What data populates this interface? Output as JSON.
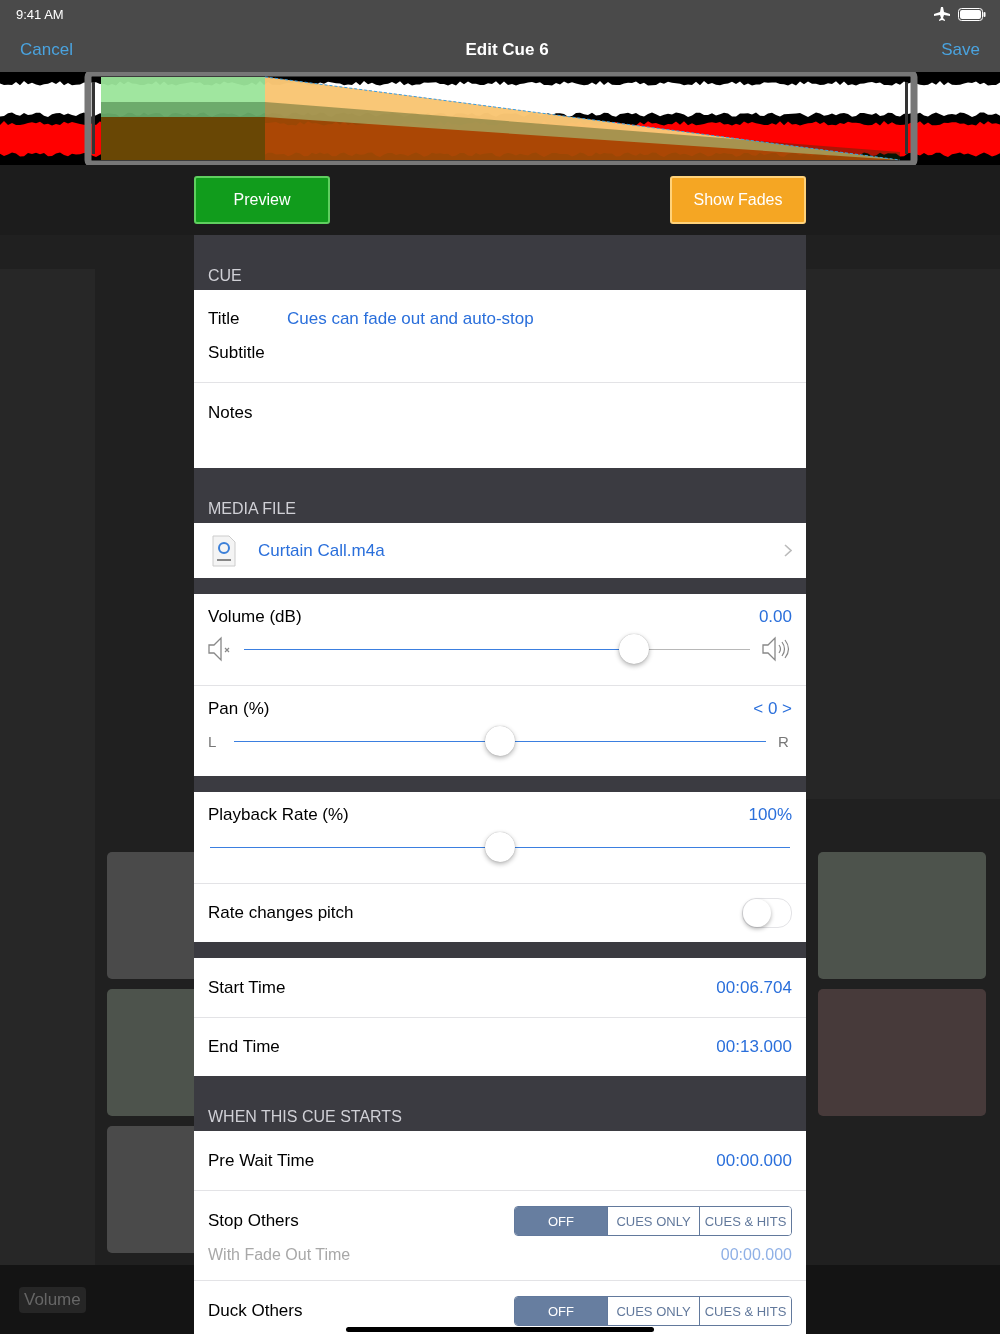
{
  "status_bar": {
    "time": "9:41 AM"
  },
  "nav": {
    "cancel": "Cancel",
    "title": "Edit Cue 6",
    "save": "Save"
  },
  "buttons": [
    {
      "label": "Preview",
      "kind": "green"
    },
    {
      "label": "Show Fades",
      "kind": "orange"
    }
  ],
  "backdrop": {
    "bottom_label": "Volume"
  },
  "sections": [
    {
      "header": "CUE",
      "rows": [
        {
          "kind": "field",
          "label": "Title",
          "value": "Cues can fade out and auto-stop"
        },
        {
          "kind": "field",
          "label": "Subtitle"
        },
        {
          "kind": "notes",
          "label": "Notes"
        }
      ]
    },
    {
      "header": "MEDIA FILE",
      "rows": [
        {
          "kind": "file",
          "name": "Curtain Call.m4a"
        }
      ]
    },
    {
      "rows": [
        {
          "kind": "speaker_slider",
          "label": "Volume (dB)",
          "value": "0.00",
          "level": 0.77
        },
        {
          "kind": "lettered_slider",
          "label": "Pan (%)",
          "value": "< 0 >",
          "min_label": "L",
          "max_label": "R",
          "level": 0.5
        }
      ]
    },
    {
      "rows": [
        {
          "kind": "plain_slider",
          "label": "Playback Rate (%)",
          "value": "100%",
          "level": 0.5
        },
        {
          "kind": "toggle",
          "label": "Rate changes pitch",
          "on": false
        }
      ]
    },
    {
      "rows": [
        {
          "kind": "value",
          "label": "Start Time",
          "value": "00:06.704"
        },
        {
          "kind": "value",
          "label": "End Time",
          "value": "00:13.000"
        }
      ]
    },
    {
      "header": "WHEN THIS CUE STARTS",
      "rows": [
        {
          "kind": "value",
          "label": "Pre Wait Time",
          "value": "00:00.000"
        },
        {
          "kind": "segmented",
          "label": "Stop Others",
          "options": [
            {
              "label": "OFF",
              "selected": true
            },
            {
              "label": "CUES ONLY",
              "selected": false
            },
            {
              "label": "CUES & HITS",
              "selected": false
            }
          ],
          "sub": {
            "label": "With Fade Out Time",
            "value": "00:00.000",
            "disabled": true
          }
        },
        {
          "kind": "segmented",
          "label": "Duck Others",
          "options": [
            {
              "label": "OFF",
              "selected": true
            },
            {
              "label": "CUES ONLY",
              "selected": false
            },
            {
              "label": "CUES & HITS",
              "selected": false
            }
          ]
        }
      ]
    }
  ]
}
